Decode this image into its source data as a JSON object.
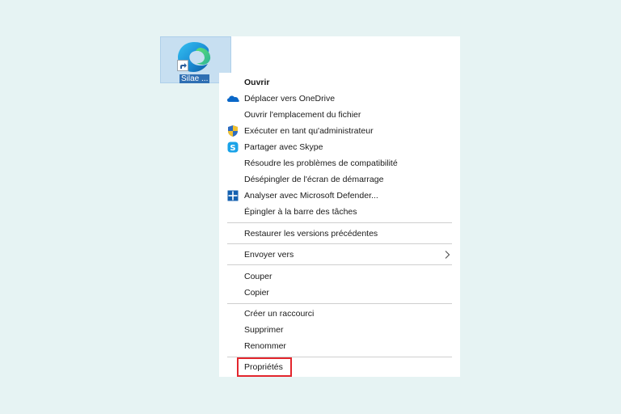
{
  "desktop": {
    "shortcut_label": "Silae ..."
  },
  "menu": {
    "ouvrir": "Ouvrir",
    "onedrive": "Déplacer vers OneDrive",
    "open_location": "Ouvrir l'emplacement du fichier",
    "run_as_admin": "Exécuter en tant qu'administrateur",
    "skype": "Partager avec Skype",
    "compat": "Résoudre les problèmes de compatibilité",
    "unpin_start": "Désépingler de l'écran de démarrage",
    "defender": "Analyser avec Microsoft Defender...",
    "pin_taskbar": "Épingler à la barre des tâches",
    "restore": "Restaurer les versions précédentes",
    "send_to": "Envoyer vers",
    "cut": "Couper",
    "copy": "Copier",
    "create_shortcut": "Créer un raccourci",
    "delete": "Supprimer",
    "rename": "Renommer",
    "properties": "Propriétés"
  },
  "colors": {
    "desktop_bg": "#e6f3f3",
    "highlight": "#e3262d",
    "selection": "#c7dff1"
  }
}
